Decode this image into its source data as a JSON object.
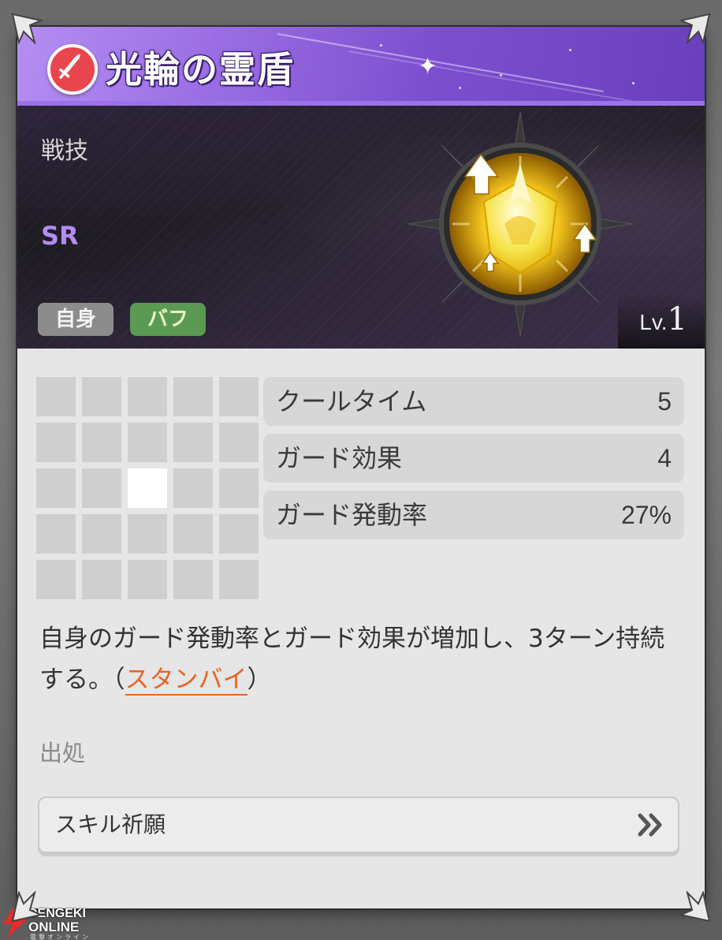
{
  "skill": {
    "name": "光輪の霊盾",
    "type_icon": "sword-icon",
    "category": "戦技",
    "rarity": "SR",
    "tags": [
      "自身",
      "バフ"
    ],
    "level_prefix": "Lv.",
    "level_value": "1"
  },
  "range_grid": {
    "rows": 5,
    "cols": 5,
    "active_cells": [
      [
        2,
        2
      ]
    ]
  },
  "stats": [
    {
      "label": "クールタイム",
      "value": "5"
    },
    {
      "label": "ガード効果",
      "value": "4"
    },
    {
      "label": "ガード発動率",
      "value": "27%"
    }
  ],
  "description": {
    "text": "自身のガード発動率とガード効果が増加し、3ターン持続する。（",
    "keyword": "スタンバイ",
    "suffix": "）"
  },
  "source": {
    "label": "出処",
    "button_text": "スキル祈願",
    "button_icon": "double-chevron-right-icon"
  },
  "watermark": {
    "line1": "DENGEKI",
    "line2": "ONLINE",
    "line3": "電撃オンライン"
  },
  "colors": {
    "title_bar": "#8a5ed8",
    "rarity": "#b58cf0",
    "tag_self": "#8c8c8c",
    "tag_buff": "#5b9a52",
    "keyword": "#e86422",
    "type_icon_bg": "#e8454f"
  }
}
